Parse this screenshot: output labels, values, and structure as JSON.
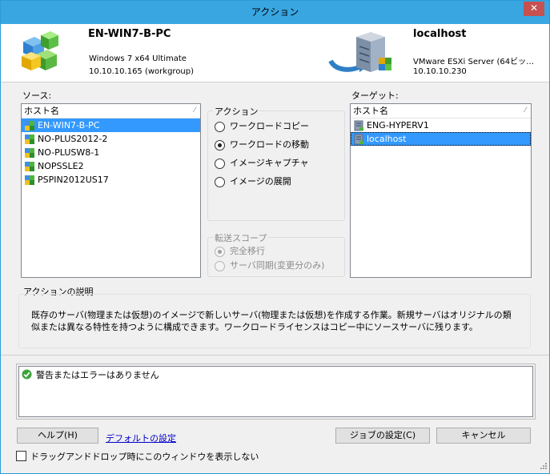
{
  "window": {
    "title": "アクション",
    "close_glyph": "✕"
  },
  "source_host": {
    "name": "EN-WIN7-B-PC",
    "os": "Windows 7 x64 Ultimate",
    "ip": "10.10.10.165 (workgroup)"
  },
  "target_host": {
    "name": "localhost",
    "os": "VMware ESXi Server (64ビッ…",
    "ip": "10.10.10.230"
  },
  "source": {
    "label": "ソース:",
    "column": "ホスト名",
    "items": [
      {
        "name": "EN-WIN7-B-PC",
        "selected": true
      },
      {
        "name": "NO-PLUS2012-2",
        "selected": false
      },
      {
        "name": "NO-PLUSW8-1",
        "selected": false
      },
      {
        "name": "NOPSSLE2",
        "selected": false
      },
      {
        "name": "PSPIN2012US17",
        "selected": false
      }
    ]
  },
  "action": {
    "label": "アクション",
    "options": [
      {
        "label": "ワークロードコピー",
        "checked": false
      },
      {
        "label": "ワークロードの移動",
        "checked": true
      },
      {
        "label": "イメージキャプチャ",
        "checked": false
      },
      {
        "label": "イメージの展開",
        "checked": false
      }
    ]
  },
  "transfer_scope": {
    "label": "転送スコープ",
    "options": [
      {
        "label": "完全移行",
        "checked": true
      },
      {
        "label": "サーバ同期(変更分のみ)",
        "checked": false
      }
    ]
  },
  "target": {
    "label": "ターゲット:",
    "column": "ホスト名",
    "items": [
      {
        "name": "ENG-HYPERV1",
        "selected": false
      },
      {
        "name": "localhost",
        "selected": true
      }
    ]
  },
  "description": {
    "label": "アクションの説明",
    "text": "既存のサーバ(物理または仮想)のイメージで新しいサーバ(物理または仮想)を作成する作業。新規サーバはオリジナルの類似または異なる特性を持つように構成できます。ワークロードライセンスはコピー中にソースサーバに残ります。"
  },
  "status": {
    "message": "警告またはエラーはありません"
  },
  "buttons": {
    "help": "ヘルプ(H)",
    "defaults": "デフォルトの設定",
    "job_settings": "ジョブの設定(C)",
    "cancel": "キャンセル"
  },
  "checkbox": {
    "label": "ドラッグアンドドロップ時にこのウィンドウを表示しない",
    "checked": false
  },
  "colors": {
    "titlebar": "#39a6e1",
    "selection": "#3399ff",
    "close": "#c75050"
  }
}
